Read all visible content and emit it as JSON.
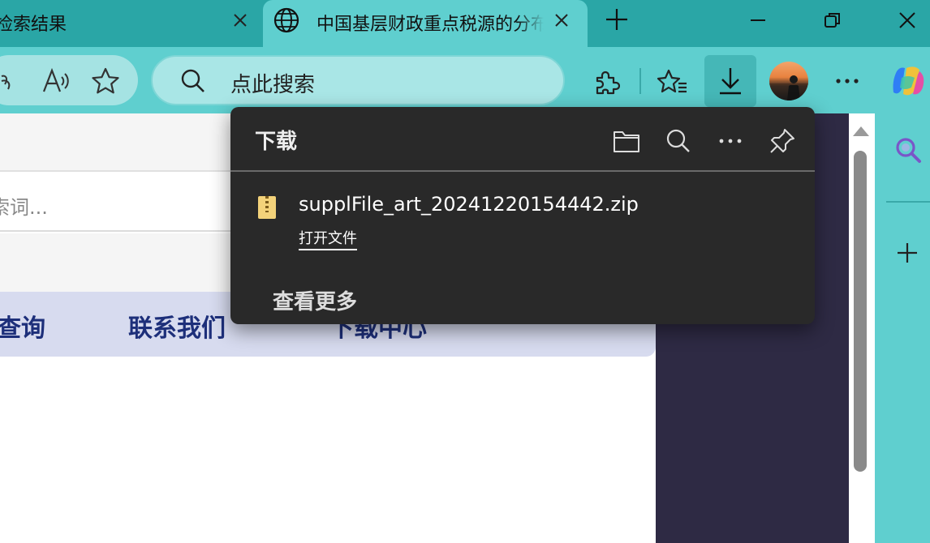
{
  "tabs": [
    {
      "title": "检索结果",
      "active": false
    },
    {
      "title": "中国基层财政重点税源的分布",
      "active": true
    }
  ],
  "address_bar": {
    "placeholder": "点此搜索"
  },
  "page": {
    "search_placeholder": "索词...",
    "nav_items": [
      "查询",
      "联系我们",
      "下载中心"
    ]
  },
  "downloads": {
    "title": "下载",
    "items": [
      {
        "filename": "supplFile_art_20241220154442.zip",
        "action": "打开文件"
      }
    ],
    "see_more": "查看更多"
  },
  "colors": {
    "frame": "#5fcfcf",
    "tabstrip": "#2aa6a6",
    "flyout_bg": "#292929",
    "nav_bg": "#d7dbef",
    "nav_text": "#1d2f7a"
  }
}
